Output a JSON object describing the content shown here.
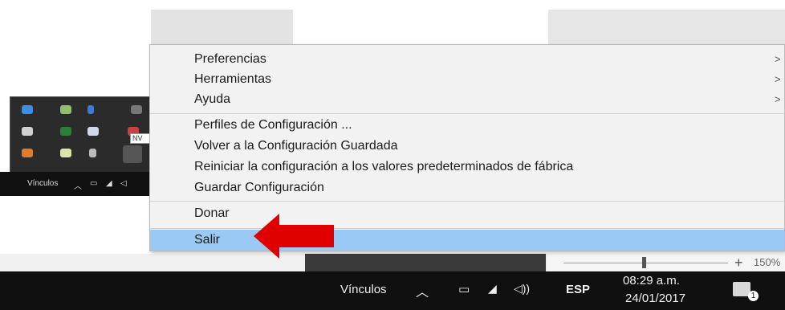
{
  "menu": {
    "submenu_items": [
      {
        "label": "Preferencias",
        "arrow": ">"
      },
      {
        "label": "Herramientas",
        "arrow": ">"
      },
      {
        "label": "Ayuda",
        "arrow": ">"
      }
    ],
    "config_items": [
      {
        "label": "Perfiles de Configuración ..."
      },
      {
        "label": "Volver a la Configuración Guardada"
      },
      {
        "label": "Reiniciar la configuración a los valores predeterminados de fábrica"
      },
      {
        "label": "Guardar Configuración"
      }
    ],
    "donate_label": "Donar",
    "exit_label": "Salir"
  },
  "tray_popup": {
    "tag_label": "NV"
  },
  "small_taskbar": {
    "links_label": "Vínculos"
  },
  "zoom": {
    "plus": "+",
    "percent": "150%"
  },
  "taskbar": {
    "links_label": "Vínculos",
    "language": "ESP",
    "time": "08:29 a.m.",
    "date": "24/01/2017",
    "notification_count": "1"
  },
  "colors": {
    "highlight": "#99c9f4",
    "taskbar": "#101010",
    "pointer_arrow": "#e00000"
  }
}
